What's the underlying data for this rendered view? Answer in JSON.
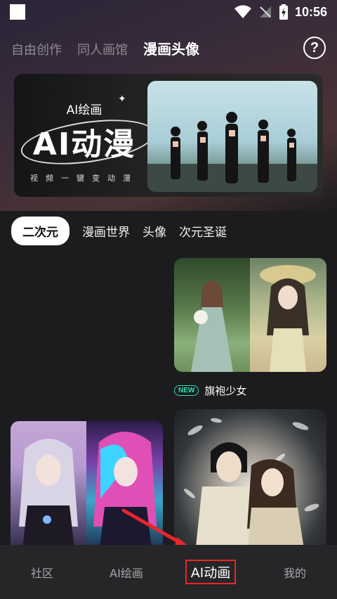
{
  "status_bar": {
    "time": "10:56"
  },
  "top_tabs": [
    {
      "label": "自由创作",
      "active": false
    },
    {
      "label": "同人画馆",
      "active": false
    },
    {
      "label": "漫画头像",
      "active": true
    }
  ],
  "help_label": "?",
  "banner": {
    "subtitle": "AI绘画",
    "title": "AI动漫",
    "tagline": "视频一键变动漫"
  },
  "category_chips": [
    {
      "label": "二次元",
      "active": true
    },
    {
      "label": "漫画世界",
      "active": false
    },
    {
      "label": "头像",
      "active": false
    },
    {
      "label": "次元圣诞",
      "active": false
    }
  ],
  "cards": [
    {
      "badge": "NEW",
      "title": "旗袍少女"
    }
  ],
  "bottom_nav": [
    {
      "label": "社区",
      "active": false
    },
    {
      "label": "AI绘画",
      "active": false
    },
    {
      "label": "AI动画",
      "active": true
    },
    {
      "label": "我的",
      "active": false
    }
  ],
  "colors": {
    "background": "#1c1c1e",
    "accent_new": "#2de0b8",
    "highlight_box": "#e8262a",
    "nav_bg": "#262628"
  }
}
